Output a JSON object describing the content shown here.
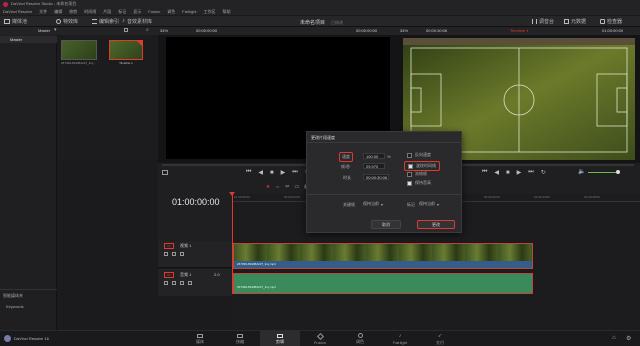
{
  "app": {
    "title": "DaVinci Resolve Studio - 未命名项目",
    "name": "DaVinci Resolve 16"
  },
  "menu": [
    "DaVinci Resolve",
    "文件",
    "编辑",
    "修剪",
    "时间线",
    "片段",
    "标记",
    "显示",
    "Fusion",
    "调色",
    "Fairlight",
    "工作区",
    "帮助"
  ],
  "toolbar": {
    "media_pool": "媒体池",
    "effects": "特效库",
    "edit_index": "编辑索引",
    "sound_library": "音效素材库",
    "project_title": "未命名项目",
    "project_state": "已修改",
    "mixer": "调音台",
    "metadata": "元数据",
    "inspector": "检查器"
  },
  "left": {
    "master": "Master",
    "smart_bins": "智能媒体夹",
    "keywords": "Keywords"
  },
  "mediapool": {
    "zoom": "Master",
    "clips": [
      {
        "name": "267399-834984227_tiny...",
        "selected": false
      },
      {
        "name": "Timeline 1",
        "selected": true
      }
    ]
  },
  "source_viewer": {
    "zoom": "34%",
    "timecode": "00:00:00:00",
    "duration": "00:00:00:00"
  },
  "timeline_viewer": {
    "zoom": "34%",
    "timecode": "00:00:30:06",
    "timeline": "Timeline 1",
    "end_timecode": "01:00:00:00"
  },
  "timeline": {
    "current_timecode": "01:00:00:00",
    "ruler": [
      "01:00:00:00",
      "01:00:04:00",
      "01:00:08:00",
      "01:00:12:00",
      "01:00:16:00",
      "01:00:20:00",
      "01:00:24:00",
      "01:00:28:00"
    ]
  },
  "tracks": {
    "video": {
      "id": "V1",
      "name": "视频 1",
      "clip": "267399-834984227_tiny.mp4"
    },
    "audio": {
      "id": "A1",
      "name": "音频 1",
      "level": "2.0",
      "clip": "267399-834984227_tiny.mp4"
    }
  },
  "dialog": {
    "title": "更改片段速度",
    "speed_label": "速度",
    "speed_value": "100.00",
    "speed_unit": "%",
    "fps_label": "帧/秒",
    "fps_value": "29.970",
    "duration_label": "时长",
    "duration_value": "00:00:30:06",
    "reverse_label": "反向速度",
    "reverse_checked": false,
    "ripple_label": "波纹时间线",
    "ripple_checked": true,
    "freeze_label": "冻结帧",
    "freeze_checked": false,
    "pitch_label": "保持音高",
    "pitch_checked": true,
    "keyframes_label": "关键帧",
    "keyframes_option": "保持当前",
    "markers_label": "标记",
    "markers_option": "保持当前",
    "cancel": "取消",
    "change": "更改"
  },
  "pages": [
    {
      "label": "媒体",
      "active": false
    },
    {
      "label": "快编",
      "active": false
    },
    {
      "label": "剪辑",
      "active": true
    },
    {
      "label": "Fusion",
      "active": false
    },
    {
      "label": "调色",
      "active": false
    },
    {
      "label": "Fairlight",
      "active": false
    },
    {
      "label": "交付",
      "active": false
    }
  ],
  "colors": {
    "accent_red": "#e03a2f",
    "video_clip": "#4b4a2c",
    "audio_clip": "#3a8a5b",
    "playhead": "#e03a2f"
  }
}
